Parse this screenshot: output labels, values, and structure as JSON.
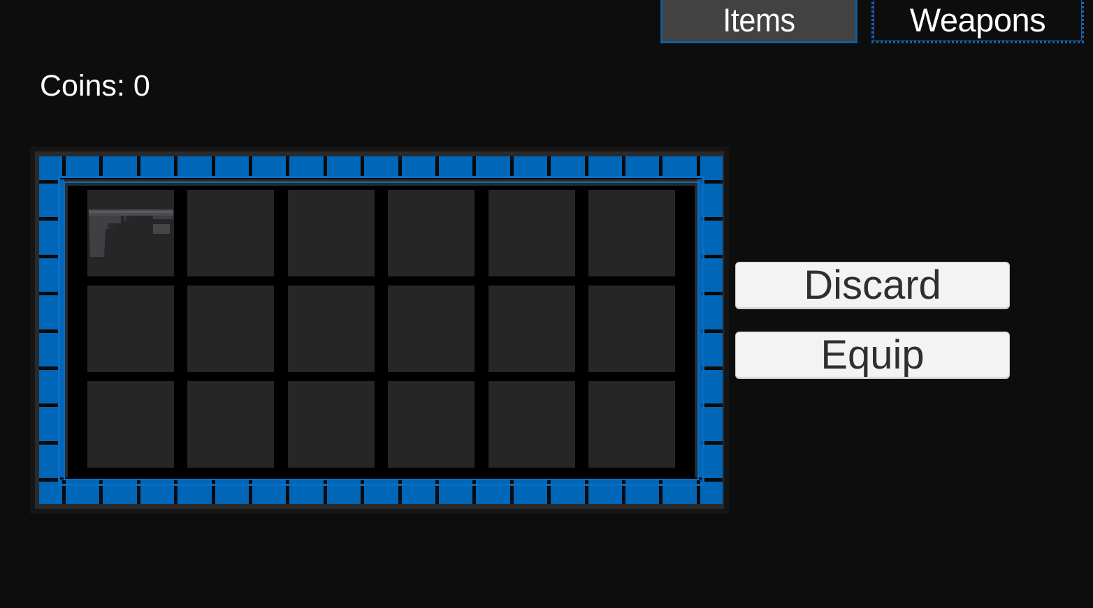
{
  "tabs": {
    "items_label": "Items",
    "weapons_label": "Weapons"
  },
  "coins": {
    "label": "Coins: 0"
  },
  "inventory": {
    "rows": 3,
    "columns": 6,
    "slots": [
      {
        "item": "pistol-icon"
      },
      {
        "item": null
      },
      {
        "item": null
      },
      {
        "item": null
      },
      {
        "item": null
      },
      {
        "item": null
      },
      {
        "item": null
      },
      {
        "item": null
      },
      {
        "item": null
      },
      {
        "item": null
      },
      {
        "item": null
      },
      {
        "item": null
      },
      {
        "item": null
      },
      {
        "item": null
      },
      {
        "item": null
      },
      {
        "item": null
      },
      {
        "item": null
      },
      {
        "item": null
      }
    ]
  },
  "actions": {
    "discard_label": "Discard",
    "equip_label": "Equip"
  },
  "colors": {
    "background": "#0d0d0d",
    "border_blue": "#0066b8",
    "slot": "#262626",
    "tab_active": "#424242",
    "button": "#f3f3f3"
  }
}
